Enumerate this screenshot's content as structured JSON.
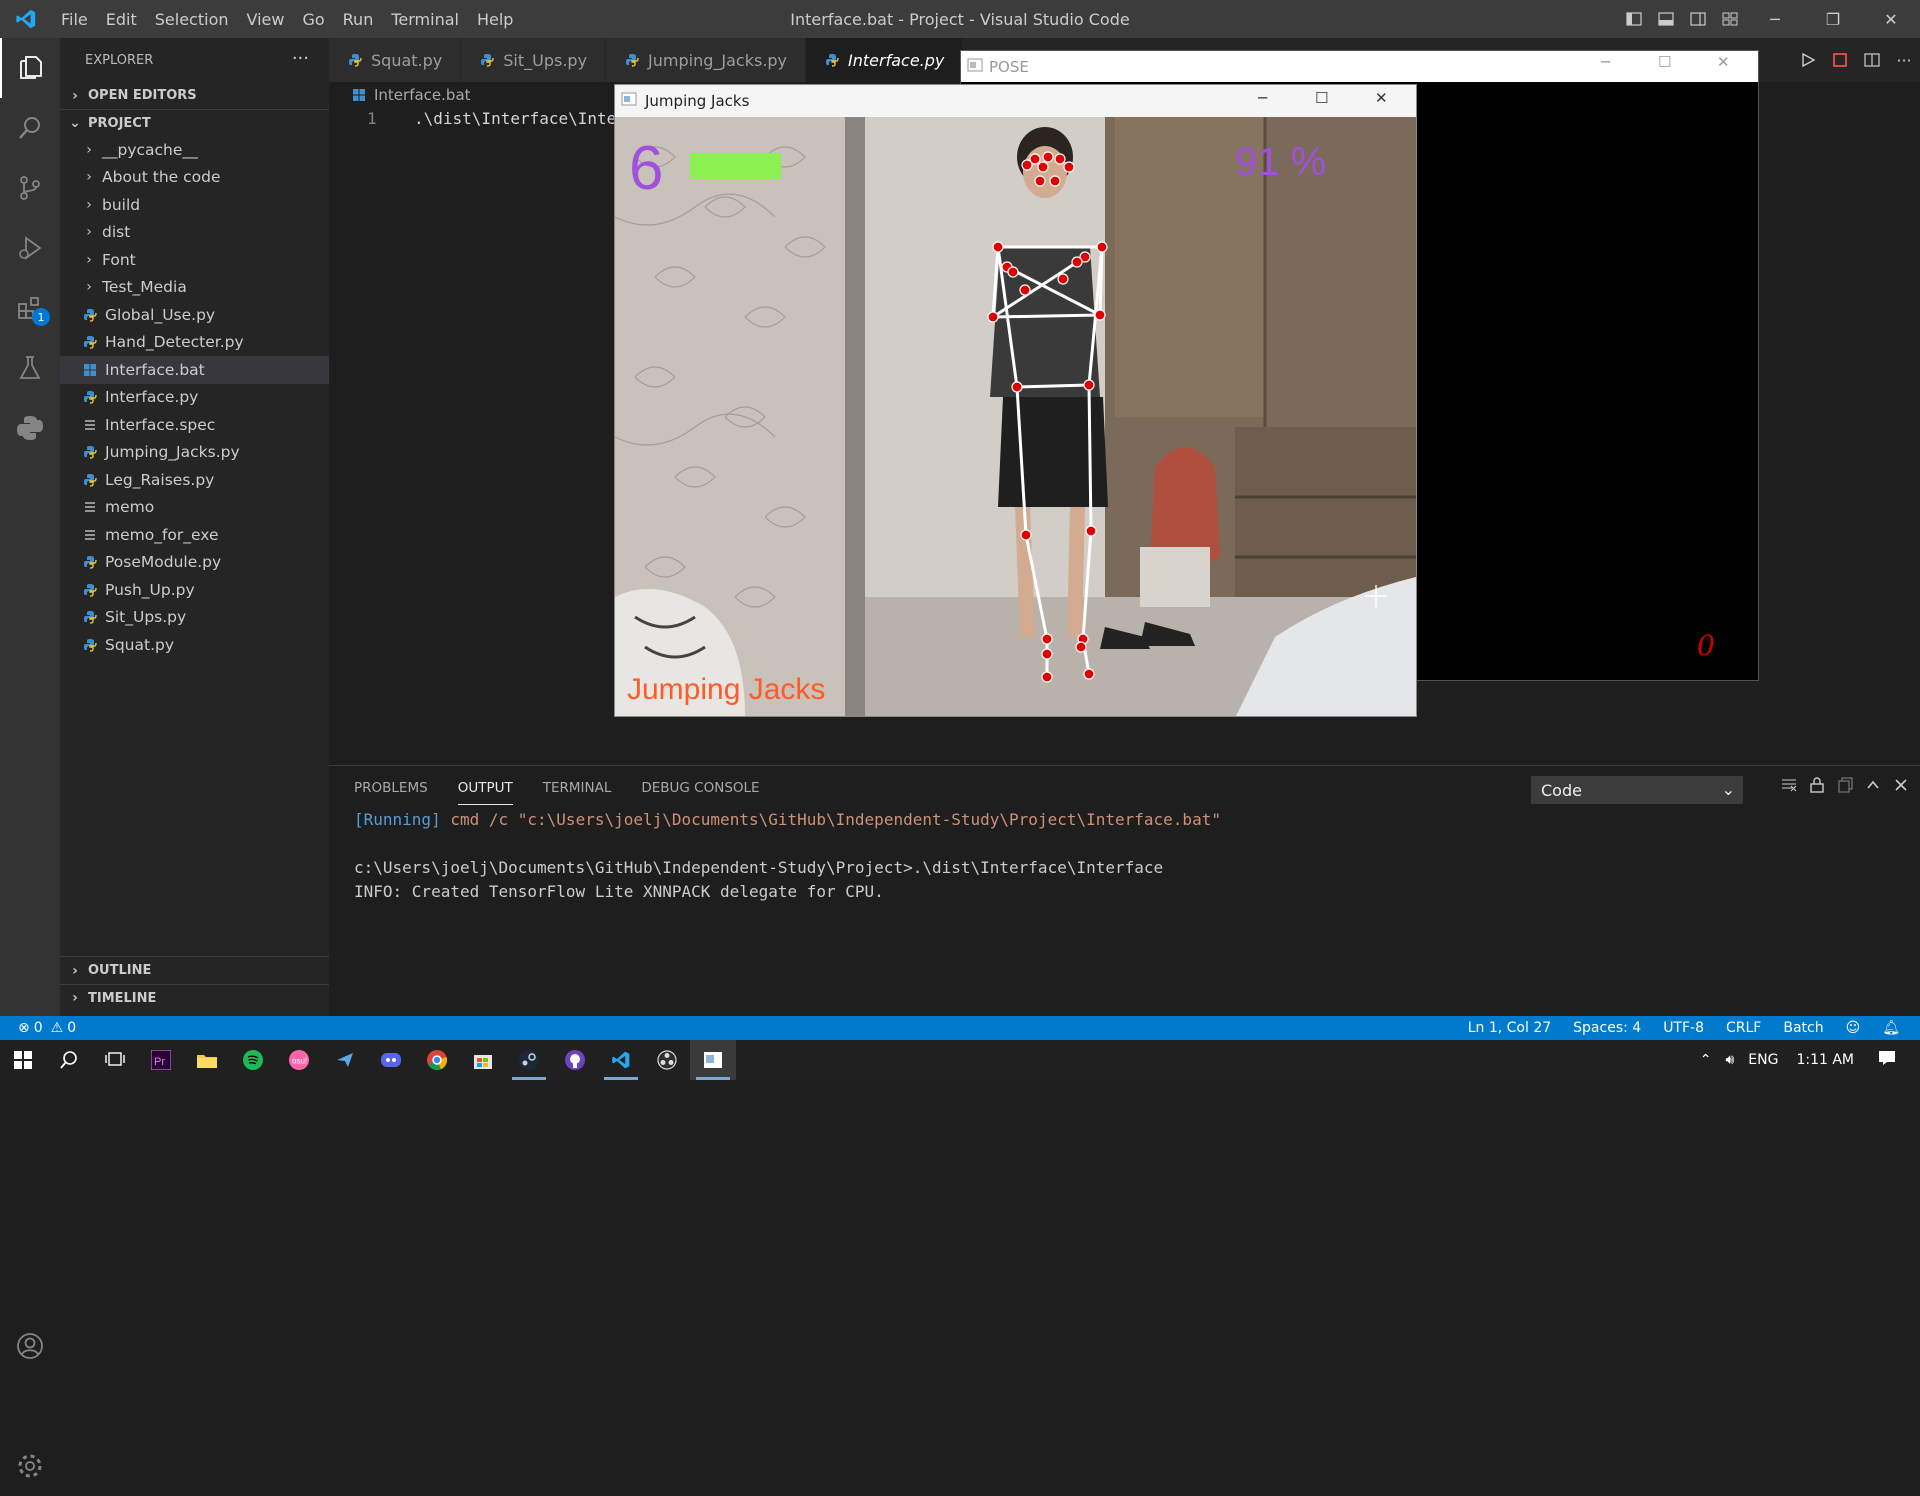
{
  "titlebar": {
    "title": "Interface.bat - Project - Visual Studio Code",
    "menu": [
      "File",
      "Edit",
      "Selection",
      "View",
      "Go",
      "Run",
      "Terminal",
      "Help"
    ]
  },
  "activity": {
    "extensions_badge": "1"
  },
  "sidebar": {
    "header": "EXPLORER",
    "open_editors": "OPEN EDITORS",
    "project": "PROJECT",
    "folders": [
      "__pycache__",
      "About the code",
      "build",
      "dist",
      "Font",
      "Test_Media"
    ],
    "files": [
      {
        "name": "Global_Use.py",
        "icon": "python-icon"
      },
      {
        "name": "Hand_Detecter.py",
        "icon": "python-icon"
      },
      {
        "name": "Interface.bat",
        "icon": "windows-icon"
      },
      {
        "name": "Interface.py",
        "icon": "python-icon"
      },
      {
        "name": "Interface.spec",
        "icon": "lines-icon"
      },
      {
        "name": "Jumping_Jacks.py",
        "icon": "python-icon"
      },
      {
        "name": "Leg_Raises.py",
        "icon": "python-icon"
      },
      {
        "name": "memo",
        "icon": "lines-icon"
      },
      {
        "name": "memo_for_exe",
        "icon": "lines-icon"
      },
      {
        "name": "PoseModule.py",
        "icon": "python-icon"
      },
      {
        "name": "Push_Up.py",
        "icon": "python-icon"
      },
      {
        "name": "Sit_Ups.py",
        "icon": "python-icon"
      },
      {
        "name": "Squat.py",
        "icon": "python-icon"
      }
    ],
    "outline": "OUTLINE",
    "timeline": "TIMELINE"
  },
  "tabs": [
    "Squat.py",
    "Sit_Ups.py",
    "Jumping_Jacks.py",
    "Interface.py"
  ],
  "editor": {
    "breadcrumb": "Interface.bat",
    "line_number": "1",
    "code": ".\\dist\\Interface\\Inte"
  },
  "panel": {
    "tabs": [
      "PROBLEMS",
      "OUTPUT",
      "TERMINAL",
      "DEBUG CONSOLE"
    ],
    "select_value": "Code",
    "running_tag": "[Running]",
    "running_cmd": " cmd /c \"c:\\Users\\joelj\\Documents\\GitHub\\Independent-Study\\Project\\Interface.bat\"",
    "line2": "c:\\Users\\joelj\\Documents\\GitHub\\Independent-Study\\Project>.\\dist\\Interface\\Interface",
    "line3": "INFO: Created TensorFlow Lite XNNPACK delegate for CPU."
  },
  "statusbar": {
    "errors": "0",
    "warnings": "0",
    "position": "Ln 1, Col 27",
    "spaces": "Spaces: 4",
    "encoding": "UTF-8",
    "eol": "CRLF",
    "language": "Batch"
  },
  "taskbar": {
    "language": "ENG",
    "time": "1:11 AM"
  },
  "pose_window": {
    "title": "POSE",
    "counter": "0"
  },
  "jj_window": {
    "title": "Jumping Jacks",
    "count": "6",
    "percent": "91 %",
    "label": "Jumping Jacks",
    "progress": 0.91
  },
  "colors": {
    "accent": "#007acc",
    "count_color": "#a050dc",
    "bar_color": "#8cf050",
    "label_color": "#ff5a28",
    "landmark_color": "#e00000"
  }
}
